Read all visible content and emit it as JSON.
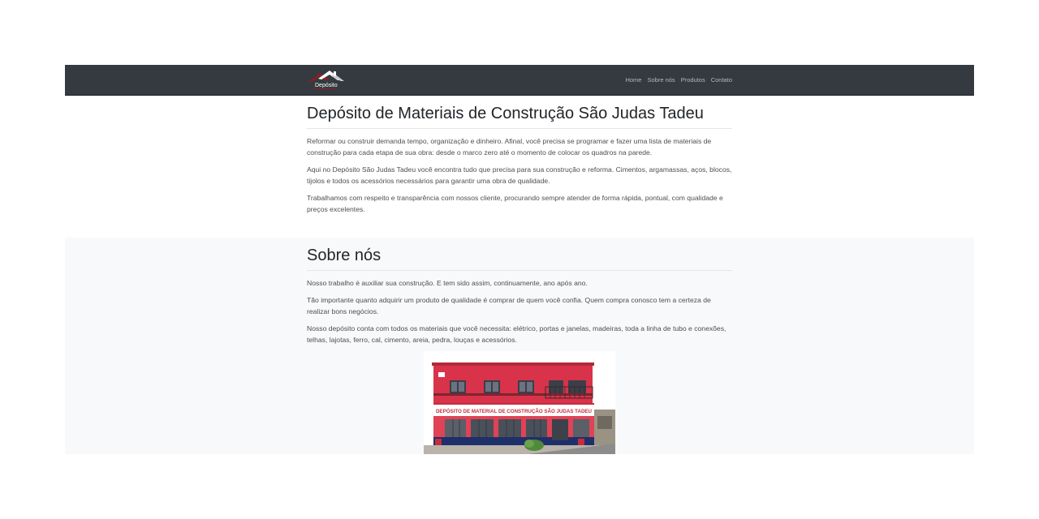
{
  "navbar": {
    "brand_text": "Depósito",
    "links": [
      "Home",
      "Sobre nós",
      "Produtos",
      "Contato"
    ]
  },
  "hero": {
    "title": "Depósito de Materiais de Construção São Judas Tadeu",
    "paragraphs": [
      "Reformar ou construir demanda tempo, organização e dinheiro. Afinal, você precisa se programar e fazer uma lista de materiais de construção para cada etapa de sua obra: desde o marco zero até o momento de colocar os quadros na parede.",
      "Aqui no Depósito São Judas Tadeu você encontra tudo que precisa para sua construção e reforma. Cimentos, argamassas, aços, blocos, tijolos e todos os acessórios necessários para garantir uma obra de qualidade.",
      "Trabalhamos com respeito e transparência com nossos cliente, procurando sempre atender de forma rápida, pontual, com qualidade e preços excelentes."
    ]
  },
  "about": {
    "title": "Sobre nós",
    "paragraphs": [
      "Nosso trabalho é auxiliar sua construção. E tem sido assim, continuamente, ano após ano.",
      "Tão importante quanto adquirir um produto de qualidade é comprar de quem você confia. Quem compra conosco tem a certeza de realizar bons negócios.",
      "Nosso depósito conta com todos os materiais que você necessita: elétrico, portas e janelas, madeiras, toda a linha de tubo e conexões, telhas, lajotas, ferro, cal, cimento, areia, pedra, louças e acessórios."
    ],
    "photo_sign_text": "DEPÓSITO DE MATERIAL DE CONSTRUÇÃO SÃO JUDAS TADEU"
  },
  "colors": {
    "navbar_bg": "#343a40",
    "section_alt_bg": "#f8f9fa",
    "building_red": "#d8334a",
    "building_navy": "#1f2f6a"
  }
}
